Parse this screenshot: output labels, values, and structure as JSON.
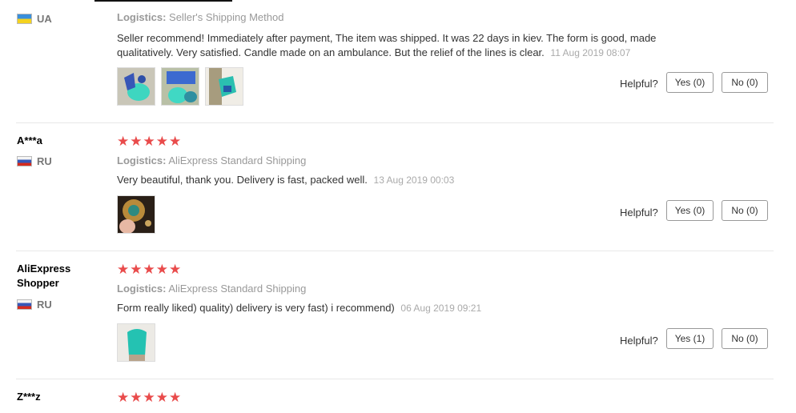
{
  "reviews": [
    {
      "user": "",
      "country": "UA",
      "stars": "★★★★★",
      "logistics_label": "Logistics:",
      "logistics_value": "Seller's Shipping Method",
      "text": "Seller recommend! Immediately after payment, The item was shipped. It was 22 days in kiev. The form is good, made qualitatively. Very satisfied. Candle made on an ambulance. But the relief of the lines is clear.",
      "date": "11 Aug 2019 08:07",
      "helpful_label": "Helpful?",
      "yes_label": "Yes (0)",
      "no_label": "No (0)"
    },
    {
      "user": "A***a",
      "country": "RU",
      "stars": "★★★★★",
      "logistics_label": "Logistics:",
      "logistics_value": "AliExpress Standard Shipping",
      "text": "Very beautiful, thank you. Delivery is fast, packed well.",
      "date": "13 Aug 2019 00:03",
      "helpful_label": "Helpful?",
      "yes_label": "Yes (0)",
      "no_label": "No (0)"
    },
    {
      "user": "AliExpress Shopper",
      "country": "RU",
      "stars": "★★★★★",
      "logistics_label": "Logistics:",
      "logistics_value": "AliExpress Standard Shipping",
      "text": "Form really liked) quality) delivery is very fast) i recommend)",
      "date": "06 Aug 2019 09:21",
      "helpful_label": "Helpful?",
      "yes_label": "Yes (1)",
      "no_label": "No (0)"
    },
    {
      "user": "Z***z",
      "stars": "★★★★★"
    }
  ],
  "colors": {
    "star": "#e94b4b",
    "muted": "#999999",
    "border": "#e8e8e8"
  }
}
